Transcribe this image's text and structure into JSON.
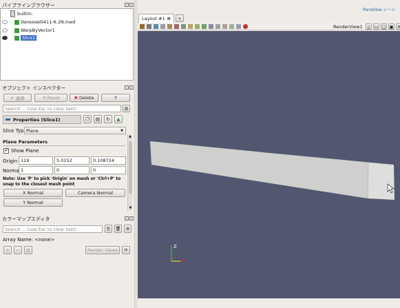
{
  "pipeline": {
    "title": "パイプラインブラウザー",
    "items": [
      {
        "label": "builtin:",
        "visible": null
      },
      {
        "label": "dansosei0411-6.2N.med",
        "visible": false
      },
      {
        "label": "WarpByVector1",
        "visible": false
      },
      {
        "label": "Slice1",
        "visible": true,
        "selected": true
      }
    ]
  },
  "inspector": {
    "title": "オブジェクト インスペクター",
    "apply_label": "適用",
    "reset_label": "Reset",
    "delete_label": "Delete",
    "help_label": "?",
    "search_placeholder": "Search ... (use Esc to clear text)",
    "properties_label": "Properties (Slice1)",
    "slice_type_label": "Slice Type",
    "slice_type_value": "Plane",
    "plane_params_label": "Plane Parameters",
    "show_plane_label": "Show Plane",
    "show_plane_checked": true,
    "origin_label": "Origin",
    "origin": [
      "119",
      "5.0152",
      "0.108724"
    ],
    "normal_label": "Normal",
    "normal": [
      "1",
      "0",
      "0"
    ],
    "note": "Note: Use 'P' to pick 'Origin' on mesh or 'Ctrl+P' to snap to the closest mesh point",
    "x_normal_label": "X Normal",
    "camera_normal_label": "Camera Normal",
    "y_normal_label": "Y Normal"
  },
  "colormap": {
    "title": "カラーマップエディタ",
    "search_placeholder": "Search ... (use Esc to clear text)",
    "array_name_label": "Array Name: <none>",
    "render_views_label": "Render Views"
  },
  "tabs": {
    "layout_label": "Layout #1",
    "add_label": "+"
  },
  "renderview": {
    "label": "RenderView1",
    "background": "#52576f",
    "object_color": "#d2d3d0",
    "axis_z": "Z"
  },
  "app": {
    "top_right_label": "ParaView シーン"
  }
}
